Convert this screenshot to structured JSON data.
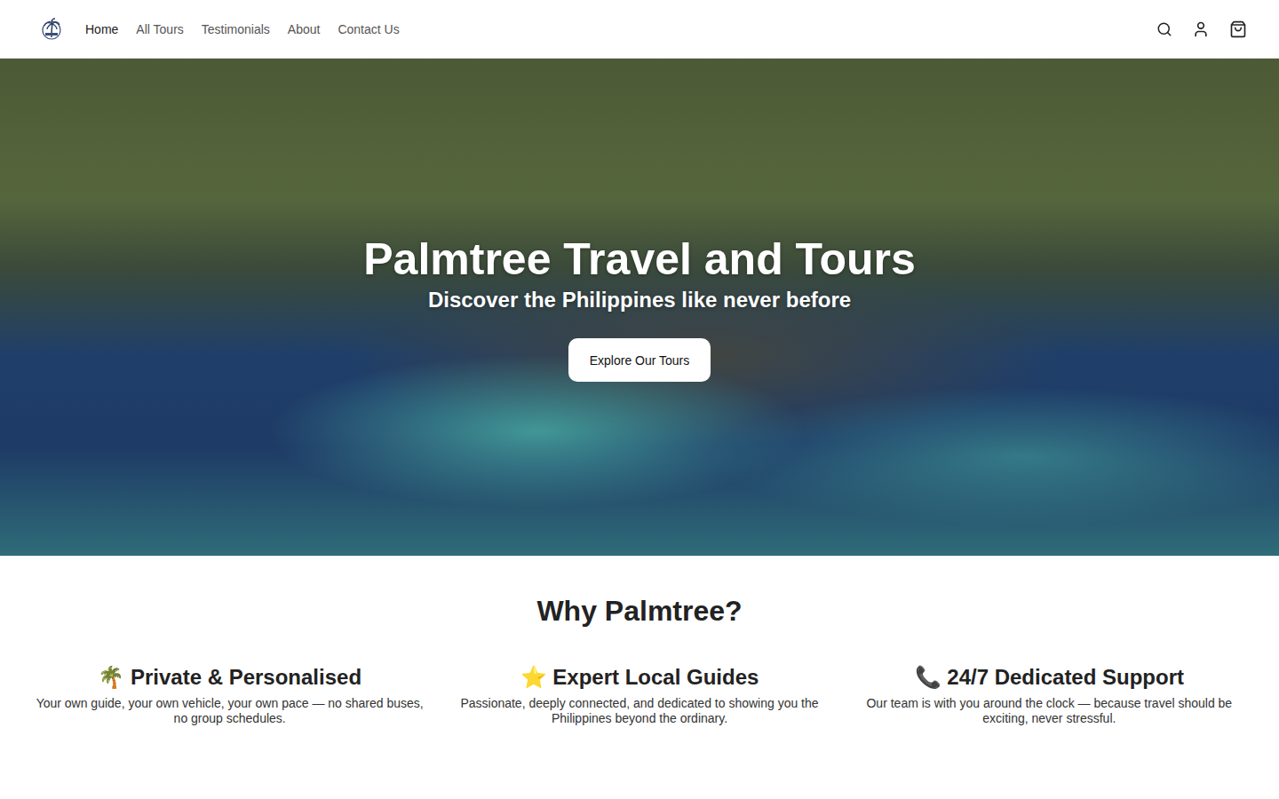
{
  "header": {
    "nav": [
      {
        "label": "Home",
        "selected": true
      },
      {
        "label": "All Tours",
        "selected": false
      },
      {
        "label": "Testimonials",
        "selected": false
      },
      {
        "label": "About",
        "selected": false
      },
      {
        "label": "Contact Us",
        "selected": false
      }
    ]
  },
  "hero": {
    "title": "Palmtree Travel and Tours",
    "subtitle": "Discover the Philippines like never before",
    "button": "Explore Our Tours"
  },
  "why": {
    "title": "Why Palmtree?",
    "features": [
      {
        "title": "🌴 Private & Personalised",
        "text": "Your own guide, your own vehicle, your own pace — no shared buses, no group schedules."
      },
      {
        "title": "⭐ Expert Local Guides",
        "text": "Passionate, deeply connected, and dedicated to showing you the Philippines beyond the ordinary."
      },
      {
        "title": "📞 24/7 Dedicated Support",
        "text": "Our team is with you around the clock — because travel should be exciting, never stressful."
      }
    ]
  }
}
